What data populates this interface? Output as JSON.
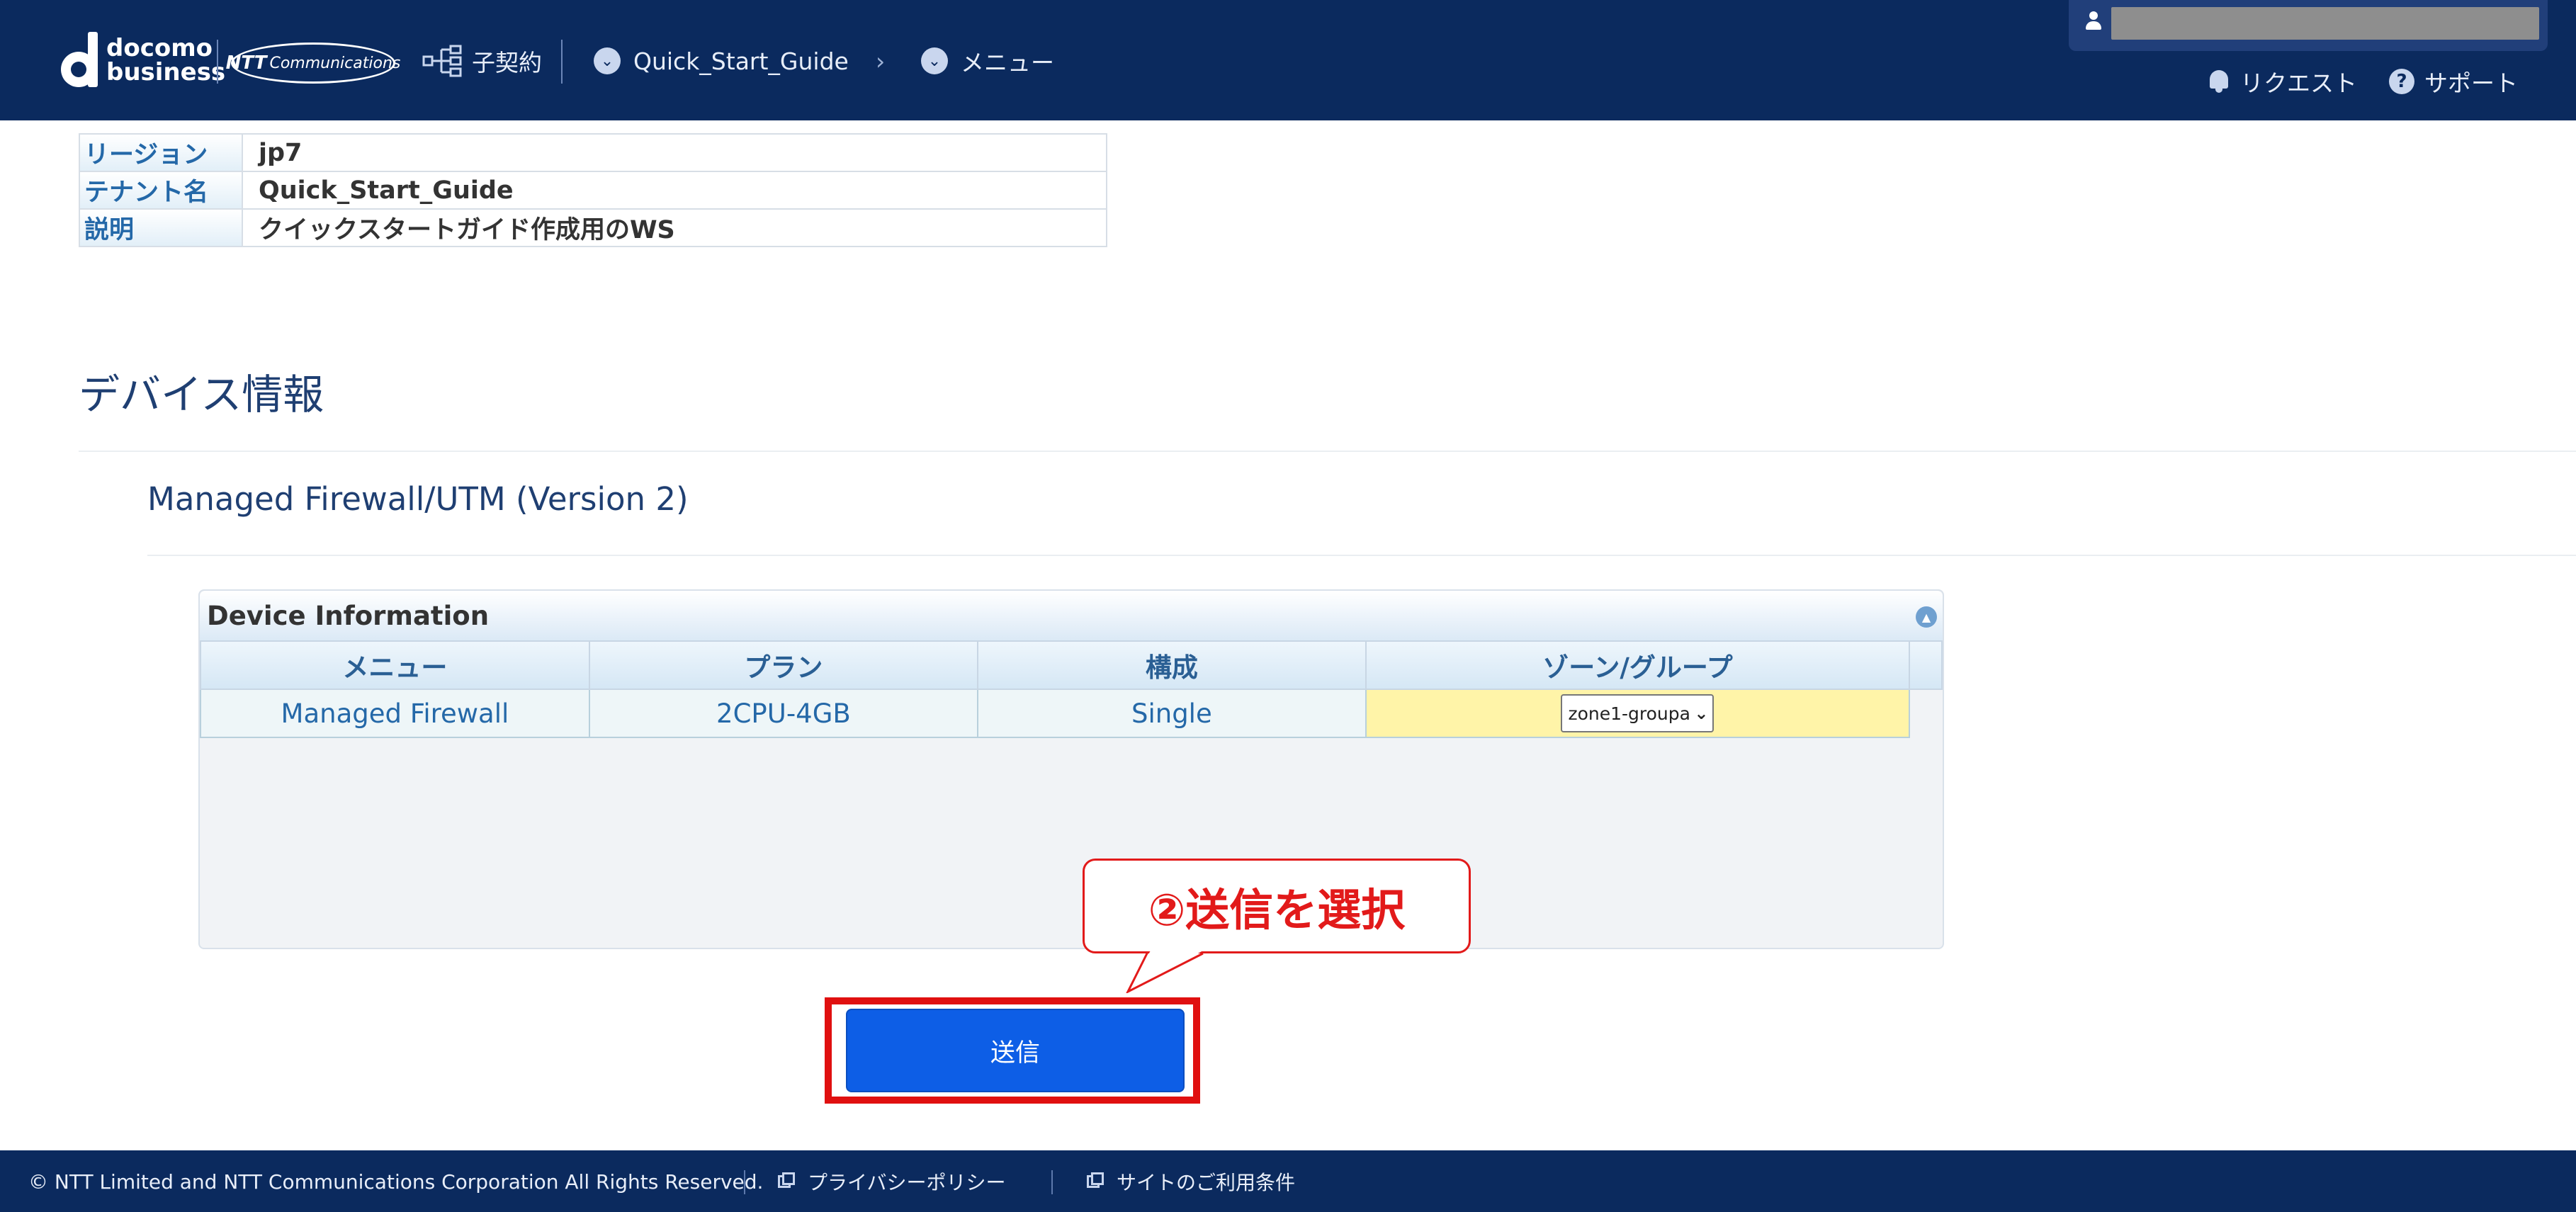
{
  "header": {
    "logo_docomo_top": "docomo",
    "logo_docomo_bottom": "business",
    "logo_ntt_bold": "NTT",
    "logo_ntt_rest": "Communications",
    "contract_label": "子契約",
    "breadcrumb_tenant": "Quick_Start_Guide",
    "breadcrumb_menu": "メニュー",
    "request_label": "リクエスト",
    "support_label": "サポート"
  },
  "info": {
    "rows": [
      {
        "label": "リージョン",
        "value": "jp7"
      },
      {
        "label": "テナント名",
        "value": "Quick_Start_Guide"
      },
      {
        "label": "説明",
        "value": "クイックスタートガイド作成用のWS"
      }
    ]
  },
  "section": {
    "title": "デバイス情報",
    "subtitle": "Managed Firewall/UTM (Version 2)"
  },
  "device_panel": {
    "title": "Device Information",
    "columns": [
      "メニュー",
      "プラン",
      "構成",
      "ゾーン/グループ"
    ],
    "row": {
      "menu": "Managed Firewall",
      "plan": "2CPU-4GB",
      "config": "Single",
      "zone_selected": "zone1-groupa"
    }
  },
  "callout": {
    "text": "②送信を選択"
  },
  "submit": {
    "label": "送信"
  },
  "footer": {
    "copyright": "© NTT Limited and NTT Communications Corporation All Rights Reserved.",
    "privacy": "プライバシーポリシー",
    "terms": "サイトのご利用条件"
  },
  "colors": {
    "header_bg": "#0b2a5e",
    "accent_red": "#e21a1a",
    "submit_blue": "#0d5ee6",
    "zone_cell_bg": "#fff4a8"
  }
}
